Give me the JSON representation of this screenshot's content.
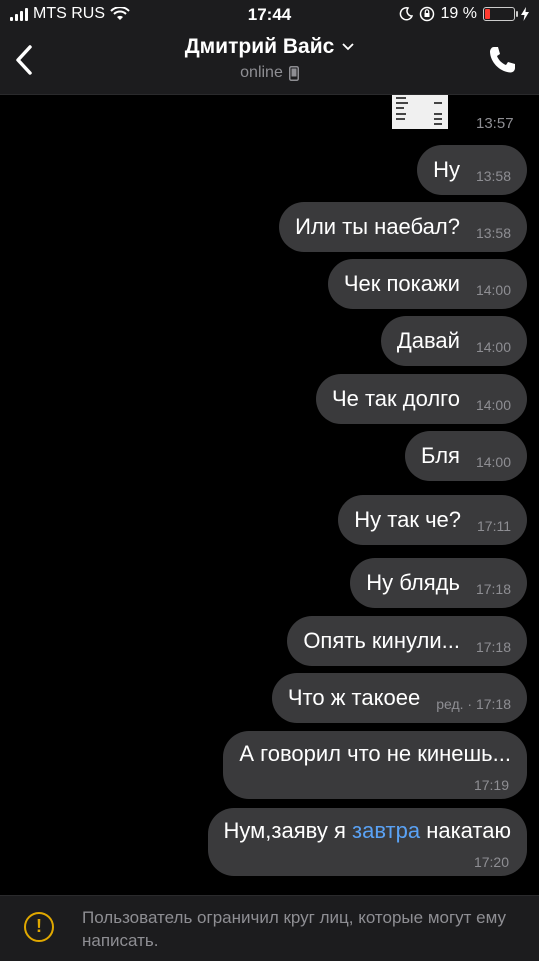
{
  "status_bar": {
    "carrier": "MTS RUS",
    "time": "17:44",
    "battery_percent": "19 %",
    "battery_level": 0.19,
    "icons": [
      "signal-icon",
      "wifi-icon",
      "moon-icon",
      "orientation-lock-icon",
      "battery-icon",
      "charging-icon"
    ]
  },
  "header": {
    "contact_name": "Дмитрий Вайс",
    "status": "online",
    "icons": [
      "back-chevron-icon",
      "chevron-down-icon",
      "mobile-device-icon",
      "phone-icon"
    ]
  },
  "chat": {
    "photo_time": "13:57",
    "messages": [
      {
        "text": "Ну",
        "time": "13:58"
      },
      {
        "text": "Или ты наебал?",
        "time": "13:58"
      },
      {
        "text": "Чек покажи",
        "time": "14:00"
      },
      {
        "text": "Давай",
        "time": "14:00"
      },
      {
        "text": "Че так долго",
        "time": "14:00"
      },
      {
        "text": "Бля",
        "time": "14:00"
      },
      {
        "text": "Ну так че?",
        "time": "17:11"
      },
      {
        "text": "Ну блядь",
        "time": "17:18"
      },
      {
        "text": "Опять кинули...",
        "time": "17:18"
      },
      {
        "text": "Что ж такоее",
        "time": "ред. · 17:18"
      },
      {
        "text": "А говорил что не кинешь...",
        "time": "17:19"
      },
      {
        "text_before": "Нум,заяву я ",
        "link": "завтра",
        "text_after": " накатаю",
        "time": "17:20"
      }
    ]
  },
  "banner": {
    "text": "Пользователь ограничил круг лиц, которые могут ему написать.",
    "icon": "warning-icon"
  },
  "colors": {
    "background": "#000000",
    "bar": "#1c1c1e",
    "bubble": "#3a3a3c",
    "link": "#5aa2f5",
    "warning": "#e0a800",
    "battery_low": "#ff3b30"
  }
}
